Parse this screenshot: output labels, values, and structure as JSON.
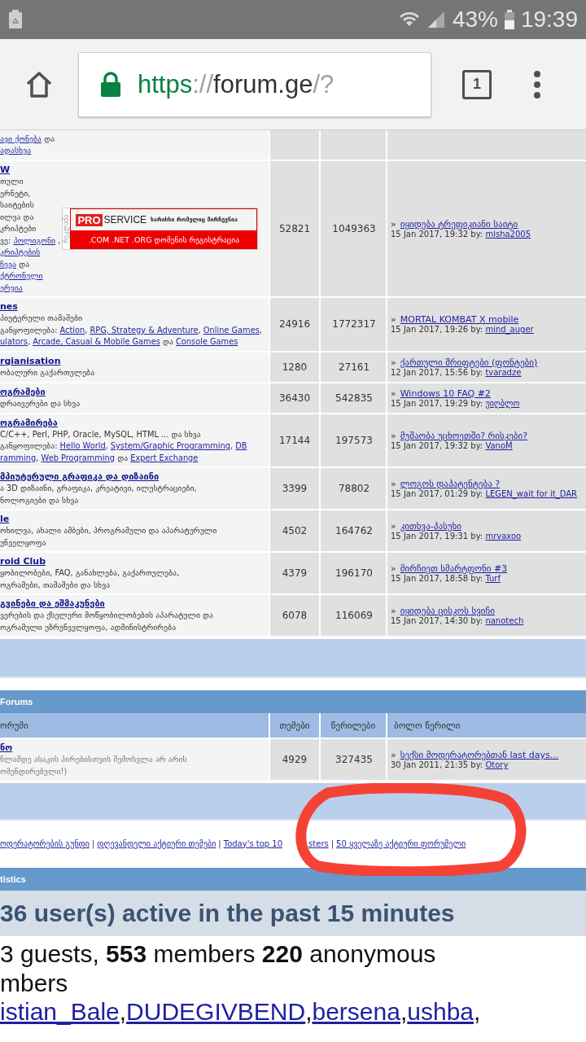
{
  "status_bar": {
    "battery": "43%",
    "time": "19:39"
  },
  "browser": {
    "scheme": "https",
    "separator": "://",
    "host": "forum.ge",
    "path": "/?",
    "tab_count": "1"
  },
  "forums": [
    {
      "lines": [
        [
          {
            "kind": "link",
            "text": "ავი ქონება"
          },
          {
            "kind": "text",
            "text": " და"
          }
        ],
        [
          {
            "kind": "link",
            "text": "ადასხვა"
          }
        ]
      ]
    },
    {
      "title": "W",
      "lines": [
        [
          {
            "kind": "text",
            "text": "თული"
          }
        ],
        [
          {
            "kind": "text",
            "text": "ერნეტი,"
          }
        ],
        [
          {
            "kind": "text",
            "text": "საიტების"
          }
        ],
        [
          {
            "kind": "text",
            "text": "ილვა და"
          }
        ],
        [
          {
            "kind": "text",
            "text": "კრიპტები"
          }
        ],
        [
          {
            "kind": "text",
            "text": "ვე: "
          },
          {
            "kind": "link",
            "text": "პოლიგონი"
          },
          {
            "kind": "text",
            "text": " ,"
          }
        ],
        [
          {
            "kind": "link",
            "text": "კრიპტების"
          }
        ],
        [
          {
            "kind": "link",
            "text": "ჩევა"
          },
          {
            "kind": "text",
            "text": " და"
          }
        ],
        [
          {
            "kind": "link",
            "text": "ქტრონული"
          }
        ],
        [
          {
            "kind": "link",
            "text": "ერვია"
          }
        ]
      ],
      "ad": {
        "tag": "რეკლამა",
        "brand_1": "PRO",
        "brand_2": "SERVICE",
        "slogan": "ხარისხი რომელიც მირჩევნია",
        "domains": ".COM .NET .ORG დომენის რეგისტრაცია"
      },
      "topics": "52821",
      "posts": "1049363",
      "last_post": {
        "arrow": "»",
        "title": "იყიდება ტრეფიკიანი საიტი",
        "date": "15 Jan 2017, 19:32 by:",
        "author": "misha2005"
      }
    },
    {
      "title": "nes",
      "lines": [
        [
          {
            "kind": "text",
            "text": "პიუტერული თამაშები"
          }
        ],
        [
          {
            "kind": "text",
            "text": "განყოფილება: "
          },
          {
            "kind": "link",
            "text": "Action"
          },
          {
            "kind": "text",
            "text": ", "
          },
          {
            "kind": "link",
            "text": "RPG, Strategy & Adventure"
          },
          {
            "kind": "text",
            "text": ", "
          },
          {
            "kind": "link",
            "text": "Online Games"
          },
          {
            "kind": "text",
            "text": ","
          }
        ],
        [
          {
            "kind": "link",
            "text": "ulators"
          },
          {
            "kind": "text",
            "text": ", "
          },
          {
            "kind": "link",
            "text": "Arcade, Casual & Mobile Games"
          },
          {
            "kind": "text",
            "text": " და "
          },
          {
            "kind": "link",
            "text": "Console Games"
          }
        ]
      ],
      "topics": "24916",
      "posts": "1772317",
      "last_post": {
        "arrow": "»",
        "title": "MORTAL KOMBAT X mobile",
        "date": "15 Jan 2017, 19:26 by:",
        "author": "mind_auger"
      }
    },
    {
      "title": "rgianisation",
      "lines": [
        [
          {
            "kind": "text",
            "text": "ობალური გაქართულება"
          }
        ]
      ],
      "topics": "1280",
      "posts": "27161",
      "last_post": {
        "arrow": "»",
        "title": "ქართული შრიფტები (ფონტები)",
        "date": "12 Jan 2017, 15:56 by:",
        "author": "tvaradze"
      }
    },
    {
      "title": "ოგრამები",
      "lines": [
        [
          {
            "kind": "text",
            "text": "დრაივერები და სხვა"
          }
        ]
      ],
      "topics": "36430",
      "posts": "542835",
      "last_post": {
        "arrow": "»",
        "title": "Windows 10 FAQ #2",
        "date": "15 Jan 2017, 19:29 by:",
        "author": "უიღბლო"
      }
    },
    {
      "title": "ოგრამირება",
      "lines": [
        [
          {
            "kind": "text",
            "text": "C/C++, Perl, PHP, Oracle, MySQL, HTML ... და სხვა"
          }
        ],
        [
          {
            "kind": "text",
            "text": "განყოფილება: "
          },
          {
            "kind": "link",
            "text": "Hello World"
          },
          {
            "kind": "text",
            "text": ", "
          },
          {
            "kind": "link",
            "text": "System/Graphic Programming"
          },
          {
            "kind": "text",
            "text": ", "
          },
          {
            "kind": "link",
            "text": "DB"
          }
        ],
        [
          {
            "kind": "link",
            "text": "ramming"
          },
          {
            "kind": "text",
            "text": ", "
          },
          {
            "kind": "link",
            "text": "Web Programming"
          },
          {
            "kind": "text",
            "text": " და "
          },
          {
            "kind": "link",
            "text": "Expert Exchange"
          }
        ]
      ],
      "topics": "17144",
      "posts": "197573",
      "last_post": {
        "arrow": "»",
        "title": "მუშაობა უცხოეთში? რისკები?",
        "date": "15 Jan 2017, 19:32 by:",
        "author": "VanoM"
      }
    },
    {
      "title": "მპიუტერული გრაფიკა და დიზაინი",
      "lines": [
        [
          {
            "kind": "text",
            "text": "ა 3D დიზაინი, გრაფიკა, კრეატივი, ილუსტრაციები,"
          }
        ],
        [
          {
            "kind": "text",
            "text": "ნოლოგიები და სხვა"
          }
        ]
      ],
      "topics": "3399",
      "posts": "78802",
      "last_post": {
        "arrow": "»",
        "title": "ლოგოს დაპატენტება ?",
        "date": "15 Jan 2017, 01:29 by:",
        "author": "LEGEN_wait for it_DAR"
      }
    },
    {
      "title": "le",
      "lines": [
        [
          {
            "kind": "text",
            "text": "ოხილვა, ახალი ამბები, პროგრამული და აპარატურული"
          }
        ],
        [
          {
            "kind": "text",
            "text": "უნველყოფა"
          }
        ]
      ],
      "topics": "4502",
      "posts": "164762",
      "last_post": {
        "arrow": "»",
        "title": "კითხვა-პასუხი",
        "date": "15 Jan 2017, 19:31 by:",
        "author": "mrvaxoo"
      }
    },
    {
      "title": "roid Club",
      "lines": [
        [
          {
            "kind": "text",
            "text": "ყობილობები, FAQ, განახლება, გაქართულება,"
          }
        ],
        [
          {
            "kind": "text",
            "text": "ოგრამები, თამაშები და სხვა"
          }
        ]
      ],
      "topics": "4379",
      "posts": "196170",
      "last_post": {
        "arrow": "»",
        "title": "მირჩიეთ სმარტფონი #3",
        "date": "15 Jan 2017, 18:58 by:",
        "author": "Turf"
      }
    },
    {
      "title": "გვინები და ეშმაკუნები",
      "lines": [
        [
          {
            "kind": "text",
            "text": "ვერების და ქსელური მოწყობილობების აპარატული და"
          }
        ],
        [
          {
            "kind": "text",
            "text": "ოგრამული უზრუნველყოფა, ადმინისტრირება"
          }
        ]
      ],
      "topics": "6078",
      "posts": "116069",
      "last_post": {
        "arrow": "»",
        "title": "იყიდება ცისკოს სვიჩი",
        "date": "15 Jan 2017, 14:30 by:",
        "author": "nanotech"
      }
    }
  ],
  "other_forums": {
    "title": "Forums",
    "columns": [
      "ორუმი",
      "თემები",
      "წერილები",
      "ბოლო წერილი"
    ],
    "rows": [
      {
        "title": "ნო",
        "lines": [
          [
            {
              "kind": "text",
              "text": "ნლამდე ასაკის პირებისთვის შემოსვლა არ არის"
            }
          ],
          [
            {
              "kind": "text",
              "text": "ომენდირებული!)"
            }
          ]
        ],
        "topics": "4929",
        "posts": "327435",
        "last_post": {
          "arrow": "»",
          "title": "სექსი მოდერატორებთან last days...",
          "date": "30 Jan 2011, 21:35 by:",
          "author": "Otory"
        }
      }
    ]
  },
  "footer_links": [
    {
      "text": "ოდერატორების გუნდი"
    },
    {
      "text": "დღევანდელი აქტიური თემები"
    },
    {
      "text": "Today's top 10",
      "after_cover": "sters"
    },
    {
      "text": "50 ყველაზე აქტიური ფორუმელი"
    }
  ],
  "link_separator": "|",
  "statistics": {
    "title": "tistics",
    "active_heading": "36 user(s) active in the past 15 minutes",
    "counts_lines": [
      "3 guests, **553** members **220** anonymous",
      "mbers"
    ],
    "users": [
      "istian_Bale",
      "DUDEGIVBEND",
      "bersena",
      "ushba"
    ],
    "user_separator": ","
  },
  "annotation": {
    "kind": "circle"
  }
}
